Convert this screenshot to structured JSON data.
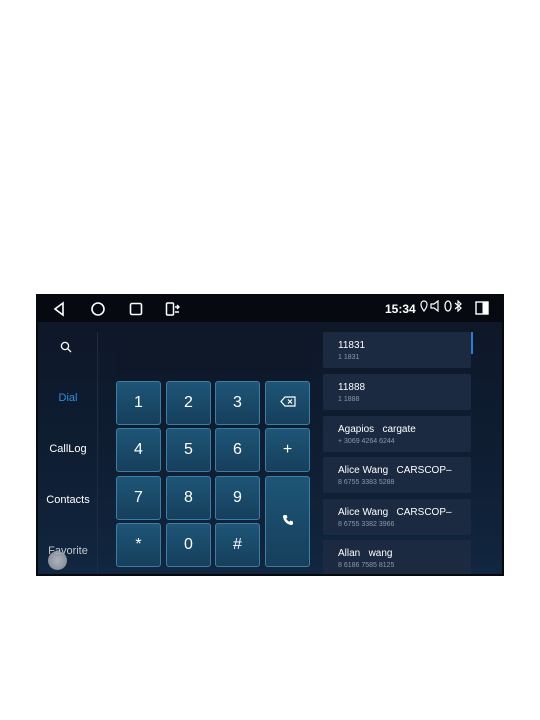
{
  "status_bar": {
    "time": "15:34",
    "icons": [
      "location-icon",
      "volume-icon",
      "signal-icon",
      "bluetooth-icon"
    ],
    "nav": [
      "back-icon",
      "home-icon",
      "recents-icon",
      "screen-mirror-icon"
    ]
  },
  "sidebar": {
    "items": [
      {
        "label": "Dial",
        "active": true
      },
      {
        "label": "CallLog",
        "active": false
      },
      {
        "label": "Contacts",
        "active": false
      },
      {
        "label": "Favorite",
        "active": false
      }
    ]
  },
  "keypad": {
    "keys": [
      "1",
      "2",
      "3",
      "4",
      "5",
      "6",
      "+",
      "7",
      "8",
      "9",
      "*",
      "0",
      "#"
    ]
  },
  "contacts": [
    {
      "name": "11831",
      "number": "1 1831"
    },
    {
      "name": "11888",
      "number": "1 1888"
    },
    {
      "name": "Agapios   cargate",
      "number": "+ 3069 4264 6244"
    },
    {
      "name": "Alice Wang   CARSCOP–",
      "number": "8 6755 3383 5288"
    },
    {
      "name": "Alice Wang   CARSCOP–",
      "number": "8 6755 3382 3966"
    },
    {
      "name": "Allan   wang",
      "number": "8 6186 7585 8125"
    }
  ],
  "colors": {
    "accent": "#2e8fe0",
    "background": "#0f1e33",
    "key": "#1e5577"
  }
}
